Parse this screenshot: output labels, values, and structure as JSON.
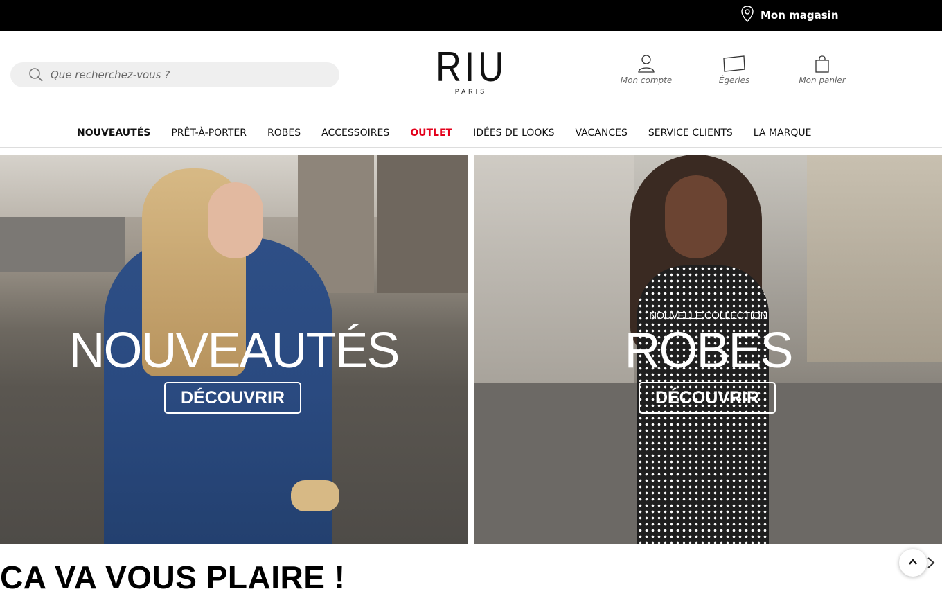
{
  "topbar": {
    "store_label": "Mon magasin"
  },
  "header": {
    "search_placeholder": "Que recherchez-vous ?",
    "logo_mark": "RIU",
    "logo_sub": "PARIS",
    "actions": [
      {
        "label": "Mon compte",
        "icon": "user-icon"
      },
      {
        "label": "Égeries",
        "icon": "card-icon"
      },
      {
        "label": "Mon panier",
        "icon": "bag-icon"
      }
    ]
  },
  "nav": {
    "items": [
      {
        "label": "NOUVEAUTÉS",
        "style": "bold"
      },
      {
        "label": "PRÊT-À-PORTER"
      },
      {
        "label": "ROBES"
      },
      {
        "label": "ACCESSOIRES"
      },
      {
        "label": "OUTLET",
        "style": "red",
        "color": "#e3001b"
      },
      {
        "label": "IDÉES DE LOOKS"
      },
      {
        "label": "VACANCES"
      },
      {
        "label": "SERVICE CLIENTS"
      },
      {
        "label": "LA MARQUE"
      }
    ]
  },
  "banners": [
    {
      "title": "NOUVEAUTÉS",
      "cta": "DÉCOUVRIR"
    },
    {
      "kicker": "NOUVELLE COLLECTION",
      "title": "ROBES",
      "cta": "DÉCOUVRIR"
    }
  ],
  "section": {
    "title": "CA VA VOUS PLAIRE !"
  },
  "colors": {
    "topbar": "#000000",
    "accent_red": "#e3001b",
    "search_bg": "#efefef"
  }
}
